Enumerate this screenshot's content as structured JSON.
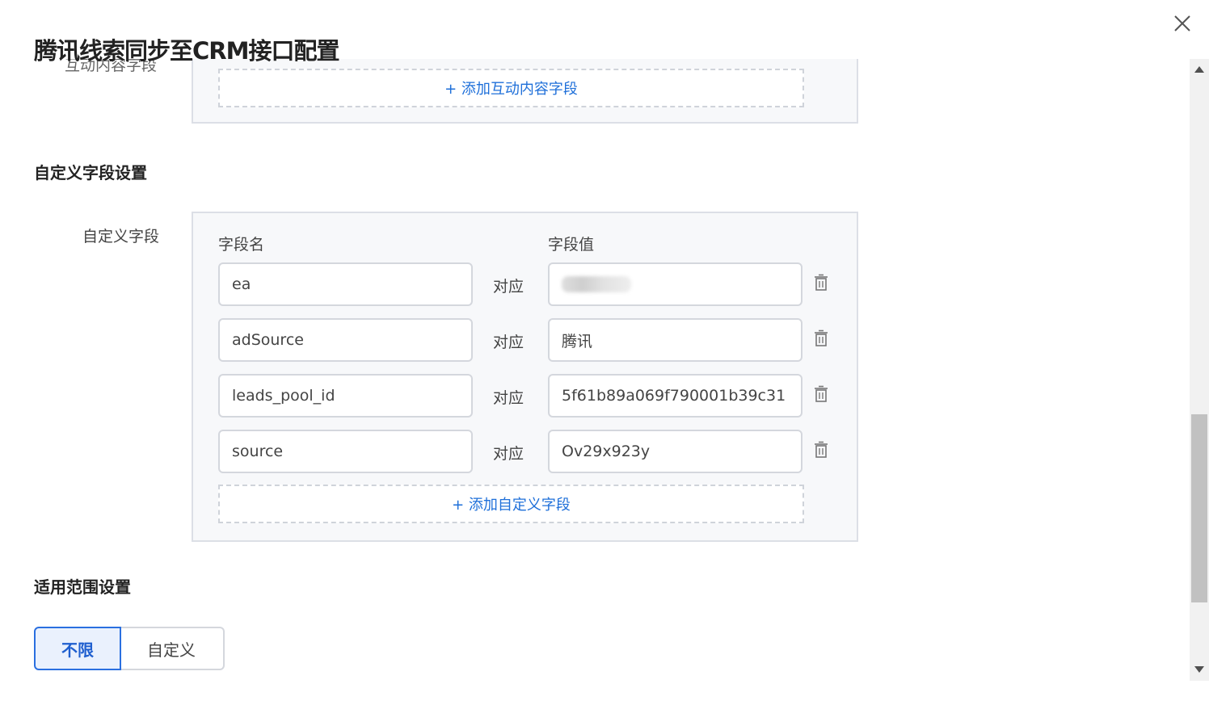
{
  "dialog": {
    "title": "腾讯线索同步至CRM接口配置"
  },
  "interaction_section": {
    "clipped_label": "互动内容字段",
    "add_label": "+ 添加互动内容字段"
  },
  "custom_section": {
    "title": "自定义字段设置",
    "field_label": "自定义字段",
    "col_name": "字段名",
    "col_value": "字段值",
    "map_word": "对应",
    "rows": [
      {
        "name": "ea",
        "value": ""
      },
      {
        "name": "adSource",
        "value": "腾讯"
      },
      {
        "name": "leads_pool_id",
        "value": "5f61b89a069f790001b39c31"
      },
      {
        "name": "source",
        "value": "Ov29x923y"
      }
    ],
    "add_label": "+ 添加自定义字段"
  },
  "scope_section": {
    "title": "适用范围设置",
    "options": [
      "不限",
      "自定义"
    ],
    "selected": "不限"
  },
  "icons": {
    "close": "close-icon",
    "delete": "trash-icon",
    "scroll_up": "triangle-up-icon",
    "scroll_down": "triangle-down-icon"
  },
  "colors": {
    "accent": "#2a6fe0",
    "link": "#1e6fd9",
    "panel_bg": "#f7f8fa"
  }
}
